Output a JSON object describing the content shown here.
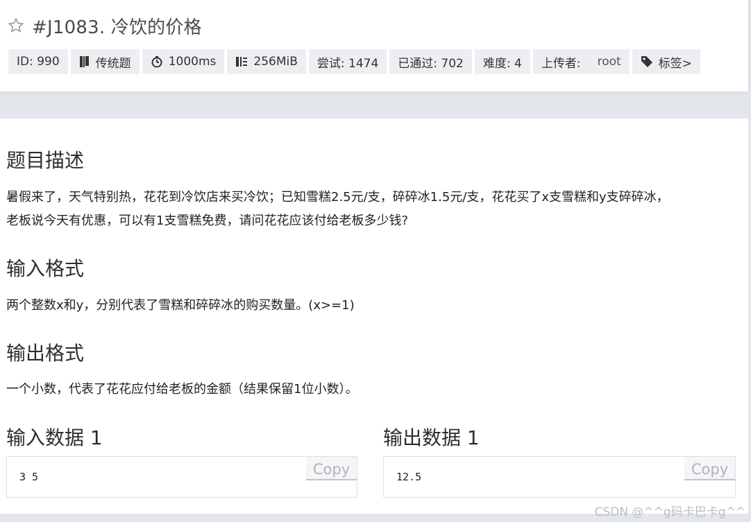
{
  "problem": {
    "title": "#J1083. 冷饮的价格",
    "tags": {
      "id": "ID: 990",
      "type": "传统题",
      "time": "1000ms",
      "memory": "256MiB",
      "attempts": "尝试: 1474",
      "passed": "已通过: 702",
      "difficulty": "难度: 4",
      "uploader_label": "上传者:",
      "uploader_name": "root",
      "labels": "标签>"
    }
  },
  "content": {
    "description_heading": "题目描述",
    "description_line1": "暑假来了，天气特别热，花花到冷饮店来买冷饮；已知雪糕2.5元/支，碎碎冰1.5元/支，花花买了x支雪糕和y支碎碎冰，",
    "description_line2": "老板说今天有优惠，可以有1支雪糕免费，请问花花应该付给老板多少钱?",
    "input_heading": "输入格式",
    "input_text": "两个整数x和y，分别代表了雪糕和碎碎冰的购买数量。(x>=1)",
    "output_heading": "输出格式",
    "output_text": "一个小数，代表了花花应付给老板的金额（结果保留1位小数）。",
    "sample_input_heading": "输入数据 1",
    "sample_input_value": "3 5",
    "sample_output_heading": "输出数据 1",
    "sample_output_value": "12.5",
    "copy_label": "Copy"
  },
  "watermark": "CSDN @^^g码卡巴卡g^^",
  "icons": {
    "star": "star-outline-icon",
    "type": "book-icon",
    "time": "stopwatch-icon",
    "memory": "memory-icon",
    "labels": "tag-icon"
  }
}
